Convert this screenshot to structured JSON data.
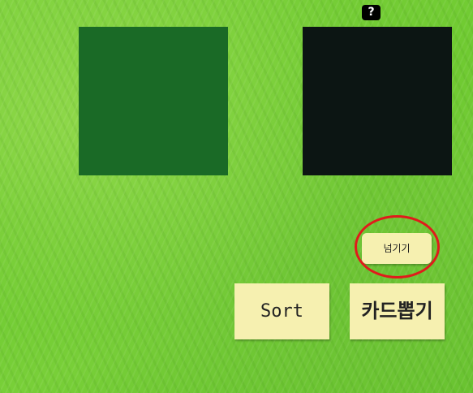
{
  "cards": {
    "left": {
      "color": "#1a6a26"
    },
    "right": {
      "color": "#0c1513"
    }
  },
  "help": {
    "label": "?",
    "icon": "question-icon"
  },
  "buttons": {
    "skip_label": "넘기기",
    "sort_label": "Sort",
    "draw_label": "카드뽑기"
  },
  "highlight": {
    "color": "#e01b1b"
  }
}
